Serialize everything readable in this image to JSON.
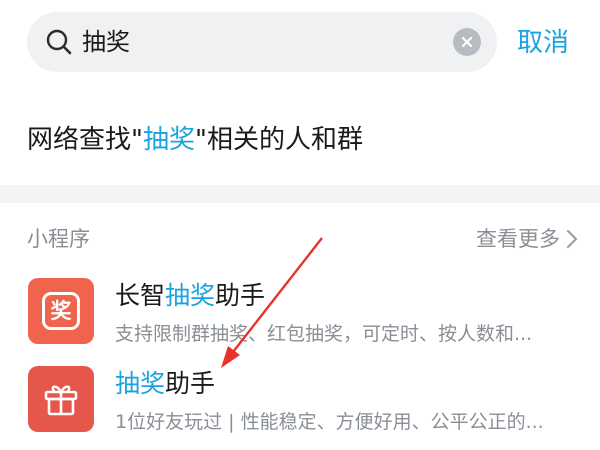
{
  "search": {
    "query": "抽奖",
    "cancel_label": "取消"
  },
  "network_search": {
    "prefix": "网络查找\"",
    "keyword": "抽奖",
    "suffix": "\"相关的人和群"
  },
  "mini_programs": {
    "section_title": "小程序",
    "more_label": "查看更多",
    "items": [
      {
        "name_prefix": "长智",
        "name_highlight": "抽奖",
        "name_suffix": "助手",
        "description": "支持限制群抽奖、红包抽奖，可定时、按人数和...",
        "icon": "lottery-char-icon",
        "icon_text": "奖",
        "icon_color": "#f0644e"
      },
      {
        "name_prefix": "",
        "name_highlight": "抽奖",
        "name_suffix": "助手",
        "description": "1位好友玩过 | 性能稳定、方便好用、公平公正的...",
        "icon": "gift-icon",
        "icon_color": "#e5564b"
      }
    ]
  },
  "colors": {
    "accent": "#1aa3e0",
    "annotation_arrow": "#e8322c"
  }
}
